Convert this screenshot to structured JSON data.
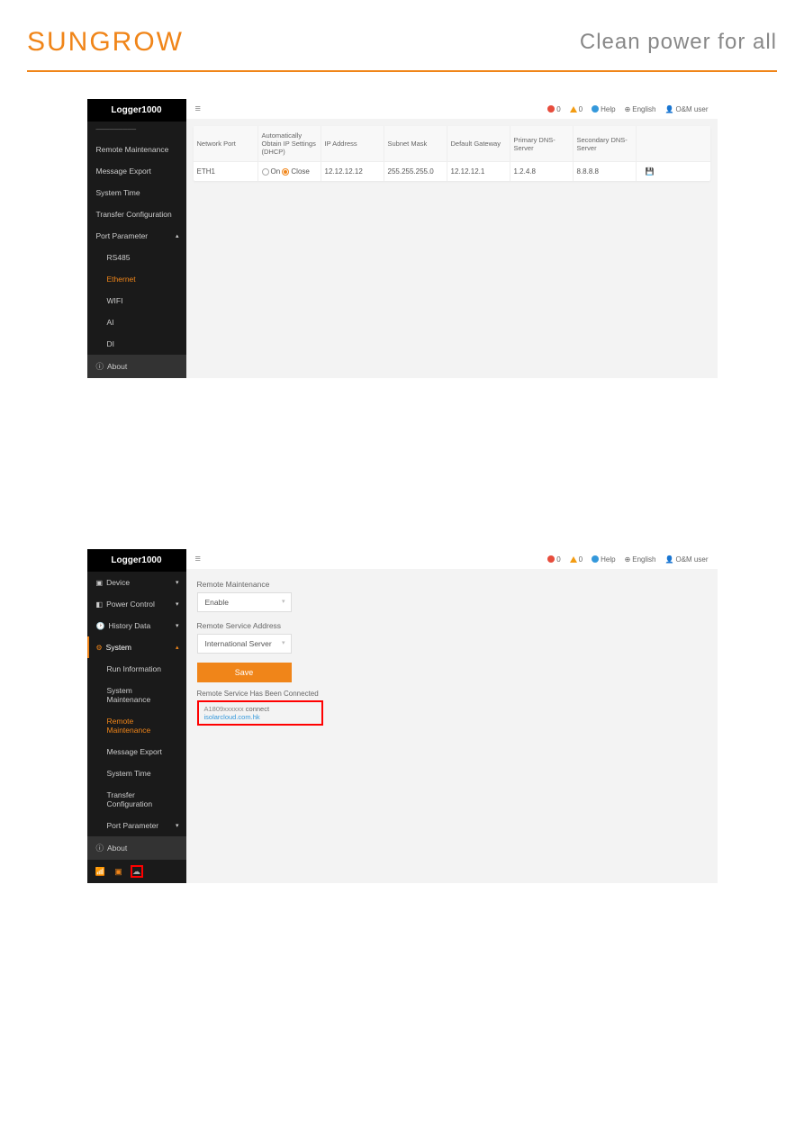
{
  "header": {
    "logo": "SUNGROW",
    "tagline": "Clean power for all"
  },
  "topbar": {
    "alerts_red": "0",
    "alerts_orange": "0",
    "help": "Help",
    "language": "English",
    "user": "O&M user"
  },
  "app1": {
    "title": "Logger1000",
    "sidebar": {
      "items": [
        {
          "label": "Remote Maintenance"
        },
        {
          "label": "Message Export"
        },
        {
          "label": "System Time"
        },
        {
          "label": "Transfer Configuration"
        },
        {
          "label": "Port Parameter"
        }
      ],
      "sub": [
        {
          "label": "RS485"
        },
        {
          "label": "Ethernet"
        },
        {
          "label": "WIFI"
        },
        {
          "label": "AI"
        },
        {
          "label": "DI"
        }
      ],
      "about": "About"
    },
    "table": {
      "headers": {
        "c1": "Network Port",
        "c2": "Automatically Obtain IP Settings (DHCP)",
        "c3": "IP Address",
        "c4": "Subnet Mask",
        "c5": "Default Gateway",
        "c6": "Primary DNS-Server",
        "c7": "Secondary DNS-Server"
      },
      "row": {
        "port": "ETH1",
        "on": "On",
        "close": "Close",
        "ip": "12.12.12.12",
        "mask": "255.255.255.0",
        "gw": "12.12.12.1",
        "dns1": "1.2.4.8",
        "dns2": "8.8.8.8"
      }
    }
  },
  "app2": {
    "title": "Logger1000",
    "sidebar": {
      "top": [
        {
          "label": "Device"
        },
        {
          "label": "Power Control"
        },
        {
          "label": "History Data"
        },
        {
          "label": "System"
        }
      ],
      "sub": [
        {
          "label": "Run Information"
        },
        {
          "label": "System Maintenance"
        },
        {
          "label": "Remote Maintenance"
        },
        {
          "label": "Message Export"
        },
        {
          "label": "System Time"
        },
        {
          "label": "Transfer Configuration"
        },
        {
          "label": "Port Parameter"
        }
      ],
      "about": "About"
    },
    "form": {
      "rm_label": "Remote Maintenance",
      "rm_value": "Enable",
      "addr_label": "Remote Service Address",
      "addr_value": "International Server",
      "save": "Save",
      "status_title": "Remote Service Has Been Connected",
      "status_ip": "A1809xxxxxx",
      "status_conn": "connect",
      "status_url": "isolarcloud.com.hk"
    }
  }
}
